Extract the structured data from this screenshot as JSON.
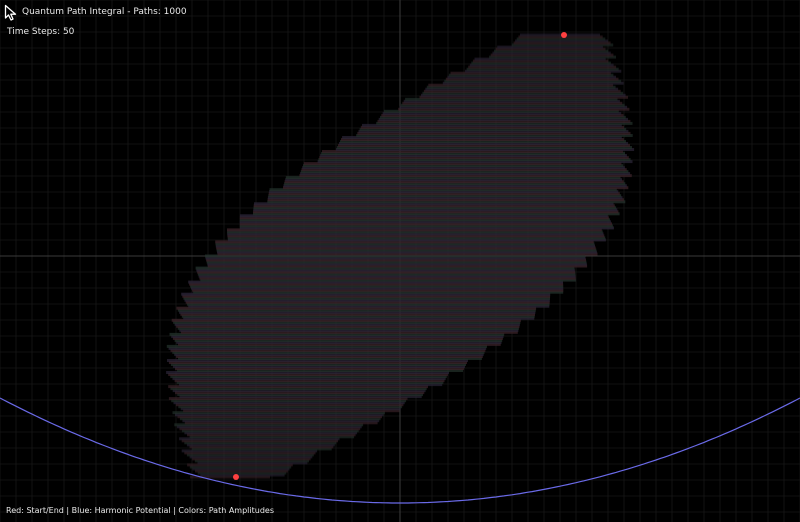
{
  "app": {
    "title": "Quantum Path Integral - Paths: 1000",
    "time_steps": "Time Steps: 50",
    "legend": "Red: Start/End | Blue: Harmonic Potential | Colors: Path Amplitudes"
  },
  "icons": {
    "cursor": "mouse-pointer-icon"
  },
  "colors": {
    "background": "#000000",
    "grid": "#1f1f1f",
    "axes": "#4a4a4a",
    "potential": "#6a6ae8",
    "endpoints": "#ff4040",
    "text": "#e8e8e8"
  },
  "simulation": {
    "paths": 1000,
    "time_steps": 50
  }
}
